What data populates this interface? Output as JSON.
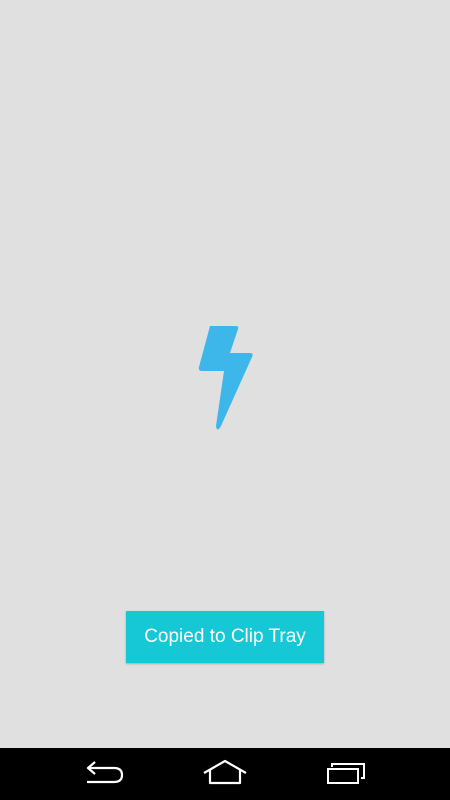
{
  "app": {
    "icon": "lightning-bolt-icon",
    "accent_color": "#3db7e9"
  },
  "toast": {
    "message": "Copied to Clip Tray",
    "background_color": "#16c8d6"
  },
  "navigation_bar": {
    "buttons": [
      {
        "icon": "back-icon"
      },
      {
        "icon": "home-icon"
      },
      {
        "icon": "recent-apps-icon"
      }
    ]
  }
}
